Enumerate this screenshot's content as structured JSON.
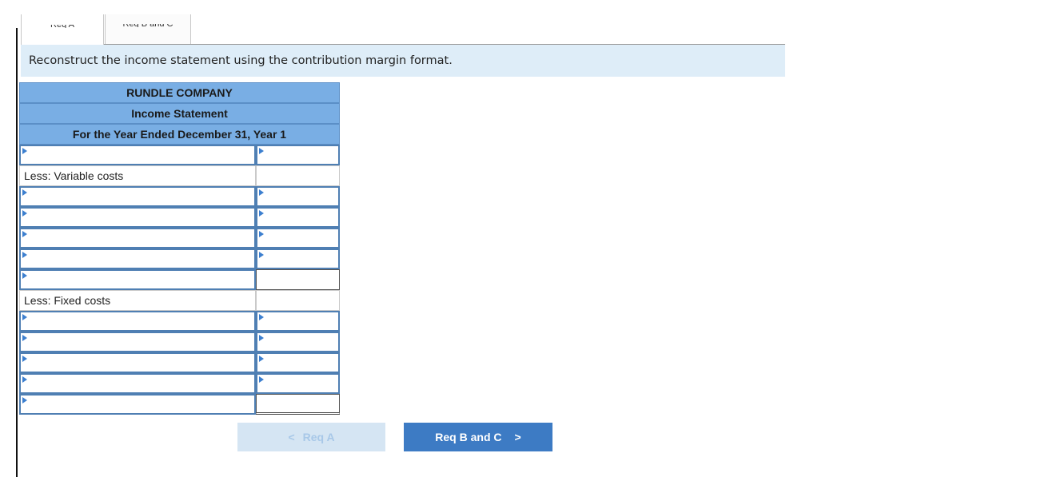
{
  "tabs": [
    {
      "label": "Req A"
    },
    {
      "label": "Req B and C"
    }
  ],
  "instruction": "Reconstruct the income statement using the contribution margin format.",
  "statement": {
    "company": "RUNDLE COMPANY",
    "title": "Income Statement",
    "period": "For the Year Ended December 31, Year 1",
    "variable_costs_label": "Less: Variable costs",
    "fixed_costs_label": "Less: Fixed costs"
  },
  "nav": {
    "prev_label": "Req A",
    "next_label": "Req B and C",
    "prev_icon": "chevron-left-icon",
    "next_icon": "chevron-right-icon"
  },
  "colors": {
    "header_fill": "#79aee4",
    "instruction_fill": "#deedf8",
    "next_button": "#3d7bc4",
    "prev_button_disabled": "#d5e5f3"
  }
}
